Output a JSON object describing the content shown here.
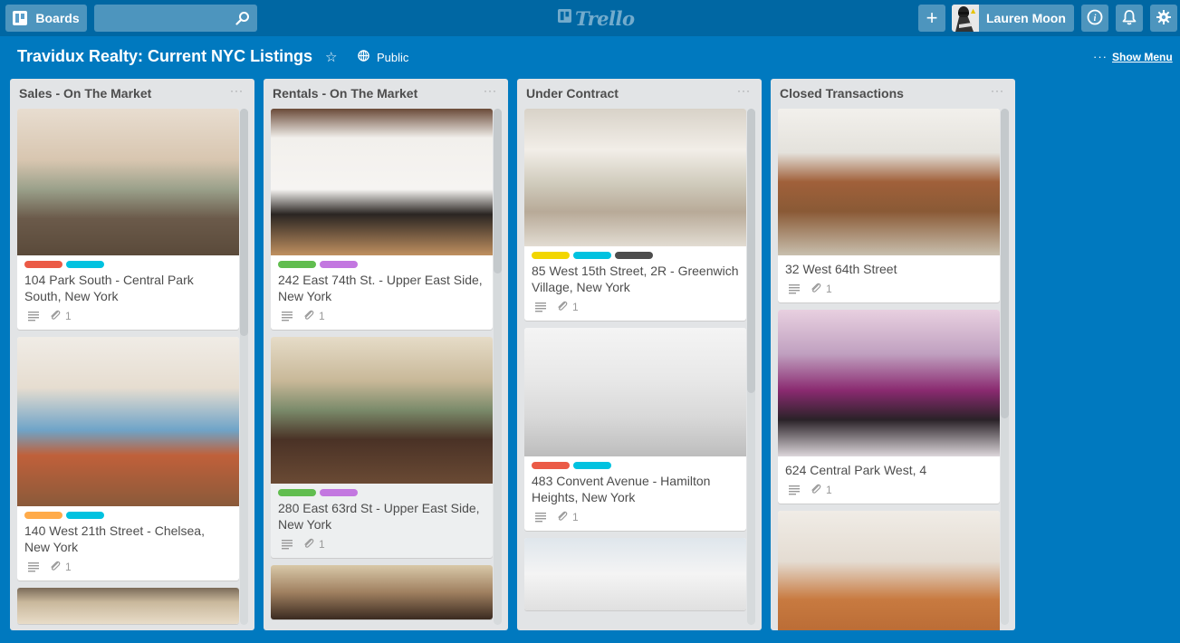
{
  "header": {
    "boards_label": "Boards",
    "search_placeholder": "",
    "logo_text": "Trello",
    "add_label": "+",
    "user_name": "Lauren Moon"
  },
  "board": {
    "title": "Travidux Realty: Current NYC Listings",
    "visibility": "Public",
    "show_menu": "Show Menu",
    "menu_dots": "···"
  },
  "colors": {
    "board_bg": "#0079bf",
    "header_bg": "#0067a3",
    "list_bg": "#e2e4e6",
    "label_red": "#eb5a46",
    "label_sky": "#00c2e0",
    "label_orange": "#ffab4a",
    "label_green": "#61bd4f",
    "label_purple": "#c377e0",
    "label_yellow": "#f2d600",
    "label_black": "#4d4d4d"
  },
  "lists": [
    {
      "title": "Sales - On The Market",
      "scroll_thumb": {
        "start": 0.0,
        "end": 0.44
      },
      "cards": [
        {
          "title": "104 Park South - Central Park South, New York",
          "labels": [
            "red",
            "sky"
          ],
          "attachments": "1",
          "has_description": true,
          "cover": "bright kitchen dining room"
        },
        {
          "title": "140 West 21th Street - Chelsea, New York",
          "labels": [
            "orange",
            "sky"
          ],
          "attachments": "1",
          "has_description": true,
          "cover": "living room with blue sofa"
        },
        {
          "title": "",
          "labels": [],
          "attachments": "",
          "has_description": false,
          "cover": "ceiling with lights"
        }
      ]
    },
    {
      "title": "Rentals - On The Market",
      "scroll_thumb": {
        "start": 0.0,
        "end": 0.32
      },
      "cards": [
        {
          "title": "242 East 74th St. - Upper East Side, New York",
          "labels": [
            "green",
            "purple"
          ],
          "attachments": "1",
          "has_description": true,
          "cover": "modern kitchen with colorful dots"
        },
        {
          "title": "280 East 63rd St - Upper East Side, New York",
          "labels": [
            "green",
            "purple"
          ],
          "attachments": "1",
          "has_description": true,
          "cover": "dining room with large table",
          "hover": true
        },
        {
          "title": "",
          "labels": [],
          "attachments": "",
          "has_description": false,
          "cover": "room with chandelier"
        }
      ]
    },
    {
      "title": "Under Contract",
      "scroll_thumb": {
        "start": 0.0,
        "end": 0.55
      },
      "cards": [
        {
          "title": "85 West 15th Street, 2R - Greenwich Village, New York",
          "labels": [
            "yellow",
            "sky",
            "black"
          ],
          "attachments": "1",
          "has_description": true,
          "cover": "living room with chandelier"
        },
        {
          "title": "483 Convent Avenue - Hamilton Heights, New York",
          "labels": [
            "red",
            "sky"
          ],
          "attachments": "1",
          "has_description": true,
          "cover": "white staircase interior"
        },
        {
          "title": "",
          "labels": [],
          "attachments": "",
          "has_description": false,
          "cover": "white room with wire pendant lamps"
        }
      ]
    },
    {
      "title": "Closed Transactions",
      "scroll_thumb": {
        "start": 0.0,
        "end": 0.6
      },
      "cards": [
        {
          "title": "32 West 64th Street",
          "labels": [],
          "attachments": "1",
          "has_description": true,
          "cover": "dining room with fruit bowl"
        },
        {
          "title": "624 Central Park West, 4",
          "labels": [],
          "attachments": "1",
          "has_description": true,
          "cover": "living room with purple curtains"
        },
        {
          "title": "",
          "labels": [],
          "attachments": "",
          "has_description": false,
          "cover": "modern kitchen with wood cabinets"
        }
      ]
    }
  ]
}
